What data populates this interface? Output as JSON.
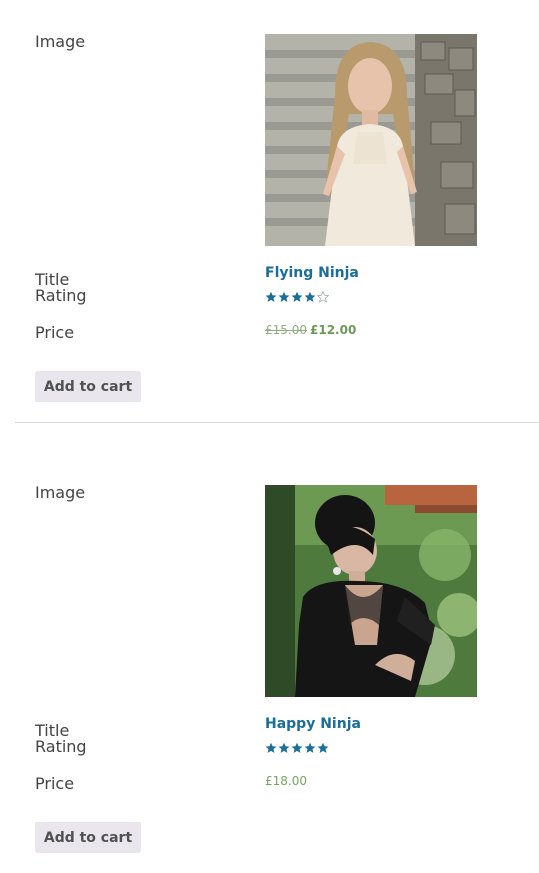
{
  "labels": {
    "image": "Image",
    "title": "Title",
    "rating": "Rating",
    "price": "Price"
  },
  "products": [
    {
      "title": "Flying Ninja",
      "rating": 4,
      "rating_max": 5,
      "price_old": "£15.00",
      "price_current": "£12.00",
      "add_to_cart": "Add to cart"
    },
    {
      "title": "Happy Ninja",
      "rating": 5,
      "rating_max": 5,
      "price_current": "£18.00",
      "add_to_cart": "Add to cart"
    }
  ],
  "colors": {
    "link": "#1a6e99",
    "star": "#1a6e99",
    "price": "#77a464",
    "button_bg": "#e9e6ed"
  }
}
